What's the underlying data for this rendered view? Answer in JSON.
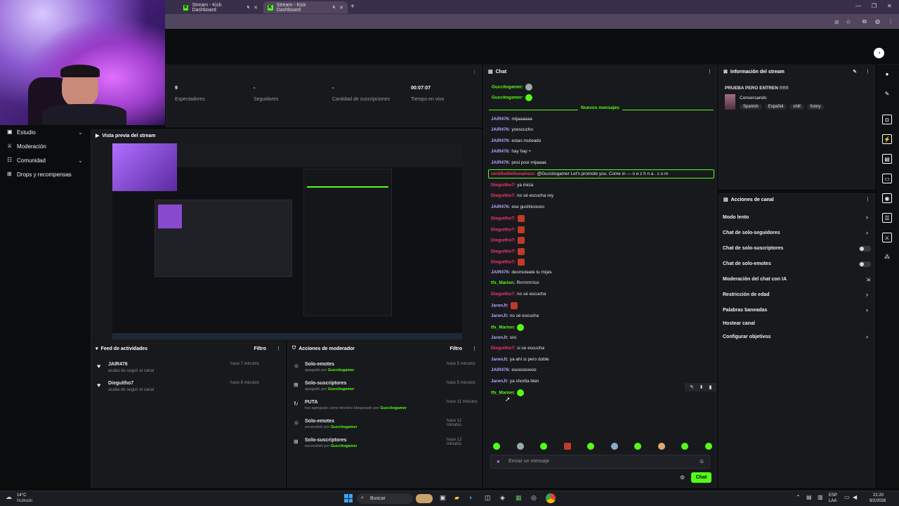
{
  "browser": {
    "tabs": [
      {
        "label": "Stream - Kick Dashboard",
        "active": false
      },
      {
        "label": "Stream - Kick Dashboard",
        "active": true
      }
    ],
    "new_tab": "+"
  },
  "sidebar": {
    "items": [
      {
        "label": "Estudio",
        "icon": "video-icon",
        "expandable": true
      },
      {
        "label": "Moderación",
        "icon": "sword-icon",
        "expandable": false
      },
      {
        "label": "Comunidad",
        "icon": "people-icon",
        "expandable": true
      },
      {
        "label": "Drops y recompensas",
        "icon": "gift-icon",
        "expandable": false
      }
    ]
  },
  "stats": [
    {
      "value": "9",
      "label": "Espectadores"
    },
    {
      "value": "-",
      "label": "Seguidores"
    },
    {
      "value": "-",
      "label": "Cantidad de suscripciones"
    },
    {
      "value": "00:07:07",
      "label": "Tiempo en vivo"
    }
  ],
  "preview": {
    "title": "Vista previa del stream"
  },
  "activity_feed": {
    "title": "Feed de actividades",
    "filter_label": "Filtro",
    "items": [
      {
        "user": "JAIR476",
        "text": "acaba de seguir al canal",
        "time": "hace 7 minutos"
      },
      {
        "user": "Dieguitho7",
        "text": "acaba de seguir al canal",
        "time": "hace 8 minutos"
      }
    ]
  },
  "mod_actions": {
    "title": "Acciones de moderador",
    "filter_label": "Filtro",
    "items": [
      {
        "title": "Solo-emotes",
        "sub": "apagado por",
        "by": "Guccitogamer",
        "time": "hace 5 minutos"
      },
      {
        "title": "Solo-suscriptores",
        "sub": "apagado por",
        "by": "Guccitogamer",
        "time": "hace 5 minutos"
      },
      {
        "title": "PUTA",
        "sub": "fue agregado como término bloqueado por",
        "by": "Guccitogamer",
        "time": "hace 11 minutos"
      },
      {
        "title": "Solo-emotes",
        "sub": "encendido por",
        "by": "Guccitogamer",
        "time": "hace 12 minutos"
      },
      {
        "title": "Solo-suscriptores",
        "sub": "encendido por",
        "by": "Guccitogamer",
        "time": "hace 12 minutos"
      }
    ]
  },
  "chat": {
    "title": "Chat",
    "new_messages": "Nuevos mensajes",
    "messages": [
      {
        "user": "Guccitogamer:",
        "text": "",
        "emote": "grey",
        "color": "green"
      },
      {
        "user": "Guccitogamer:",
        "text": "",
        "emote": "green",
        "color": "green"
      },
      {
        "user": "JAIR476:",
        "text": "mijaaaaaa",
        "color": "blue"
      },
      {
        "user": "JAIR476:",
        "text": "yoescucho",
        "color": "blue"
      },
      {
        "user": "JAIR476:",
        "text": "estas muteado",
        "color": "blue"
      },
      {
        "user": "JAIR476:",
        "text": "hay hay +",
        "color": "blue"
      },
      {
        "user": "JAIR476:",
        "text": "posi posi mijaaaa",
        "color": "blue"
      },
      {
        "user": "certifiedbillionairezz:",
        "text": "@Guccitogamer Let's promote you. Come in — n e z h n a . c o m",
        "color": "red",
        "highlight": true
      },
      {
        "user": "Dieguitho7:",
        "text": "ya inicia",
        "color": "red"
      },
      {
        "user": "Dieguitho7:",
        "text": "no sé escucha rey",
        "color": "red"
      },
      {
        "user": "JAIR476:",
        "text": "ese gushiiooooo",
        "color": "blue"
      },
      {
        "user": "Dieguitho7:",
        "text": "",
        "emote": "red",
        "color": "red"
      },
      {
        "user": "Dieguitho7:",
        "text": "",
        "emote": "red",
        "color": "red"
      },
      {
        "user": "Dieguitho7:",
        "text": "",
        "emote": "red",
        "color": "red"
      },
      {
        "user": "Dieguitho7:",
        "text": "",
        "emote": "red",
        "color": "red"
      },
      {
        "user": "Dieguitho7:",
        "text": "",
        "emote": "red",
        "color": "red"
      },
      {
        "user": "JAIR476:",
        "text": "desmuteate tu mijas",
        "color": "blue"
      },
      {
        "user": "tfx_Marion:",
        "text": "Rrrrrrrrrrico",
        "color": "green"
      },
      {
        "user": "Dieguitho7:",
        "text": "no sé escucha",
        "color": "red"
      },
      {
        "user": "JarenJt:",
        "text": "",
        "emote": "red",
        "color": "blue"
      },
      {
        "user": "JarenJt:",
        "text": "no sé escucha",
        "color": "blue"
      },
      {
        "user": "tfx_Marion:",
        "text": "",
        "emote": "green",
        "color": "green"
      },
      {
        "user": "JarenJt:",
        "text": "sisi",
        "color": "blue"
      },
      {
        "user": "Dieguitho7:",
        "text": "si se escucha",
        "color": "red"
      },
      {
        "user": "JarenJt:",
        "text": "ya ahí si pero doble",
        "color": "blue"
      },
      {
        "user": "JAIR476:",
        "text": "esoooooooo",
        "color": "blue"
      },
      {
        "user": "JarenJt:",
        "text": "ya shorita bien",
        "color": "blue"
      },
      {
        "user": "tfx_Marion:",
        "text": "",
        "emote": "green",
        "color": "green"
      }
    ],
    "input_placeholder": "Enviar un mensaje",
    "send_label": "Chat"
  },
  "stream_info": {
    "header": "Información del stream",
    "title": "PRUEBA PERO ENTREN !!!!!!",
    "category": "Conversando",
    "tags": [
      "Spanish",
      "Español",
      "chill",
      "funny"
    ]
  },
  "channel_actions": {
    "header": "Acciones de canal",
    "items": [
      {
        "label": "Modo lento",
        "control": "chevron"
      },
      {
        "label": "Chat de solo-seguidores",
        "control": "chevron"
      },
      {
        "label": "Chat de solo-suscriptores",
        "control": "toggle"
      },
      {
        "label": "Chat de solo-emotes",
        "control": "toggle"
      },
      {
        "label": "Moderación del chat con IA",
        "control": "external"
      },
      {
        "label": "Restricción de edad",
        "control": "chevron"
      },
      {
        "label": "Palabras baneadas",
        "control": "chevron"
      },
      {
        "label": "Hostear canal",
        "control": "none"
      },
      {
        "label": "Configurar objetivos",
        "control": "chevron"
      }
    ]
  },
  "taskbar": {
    "weather_temp": "14°C",
    "weather_desc": "Nublado",
    "search_label": "Buscar",
    "lang": "ESP",
    "lang2": "LAA",
    "time": "21:20",
    "date": "9/2/2026"
  },
  "colors": {
    "kick_green": "#53fc18",
    "panel": "#18191c",
    "bg": "#0b0c0e"
  }
}
